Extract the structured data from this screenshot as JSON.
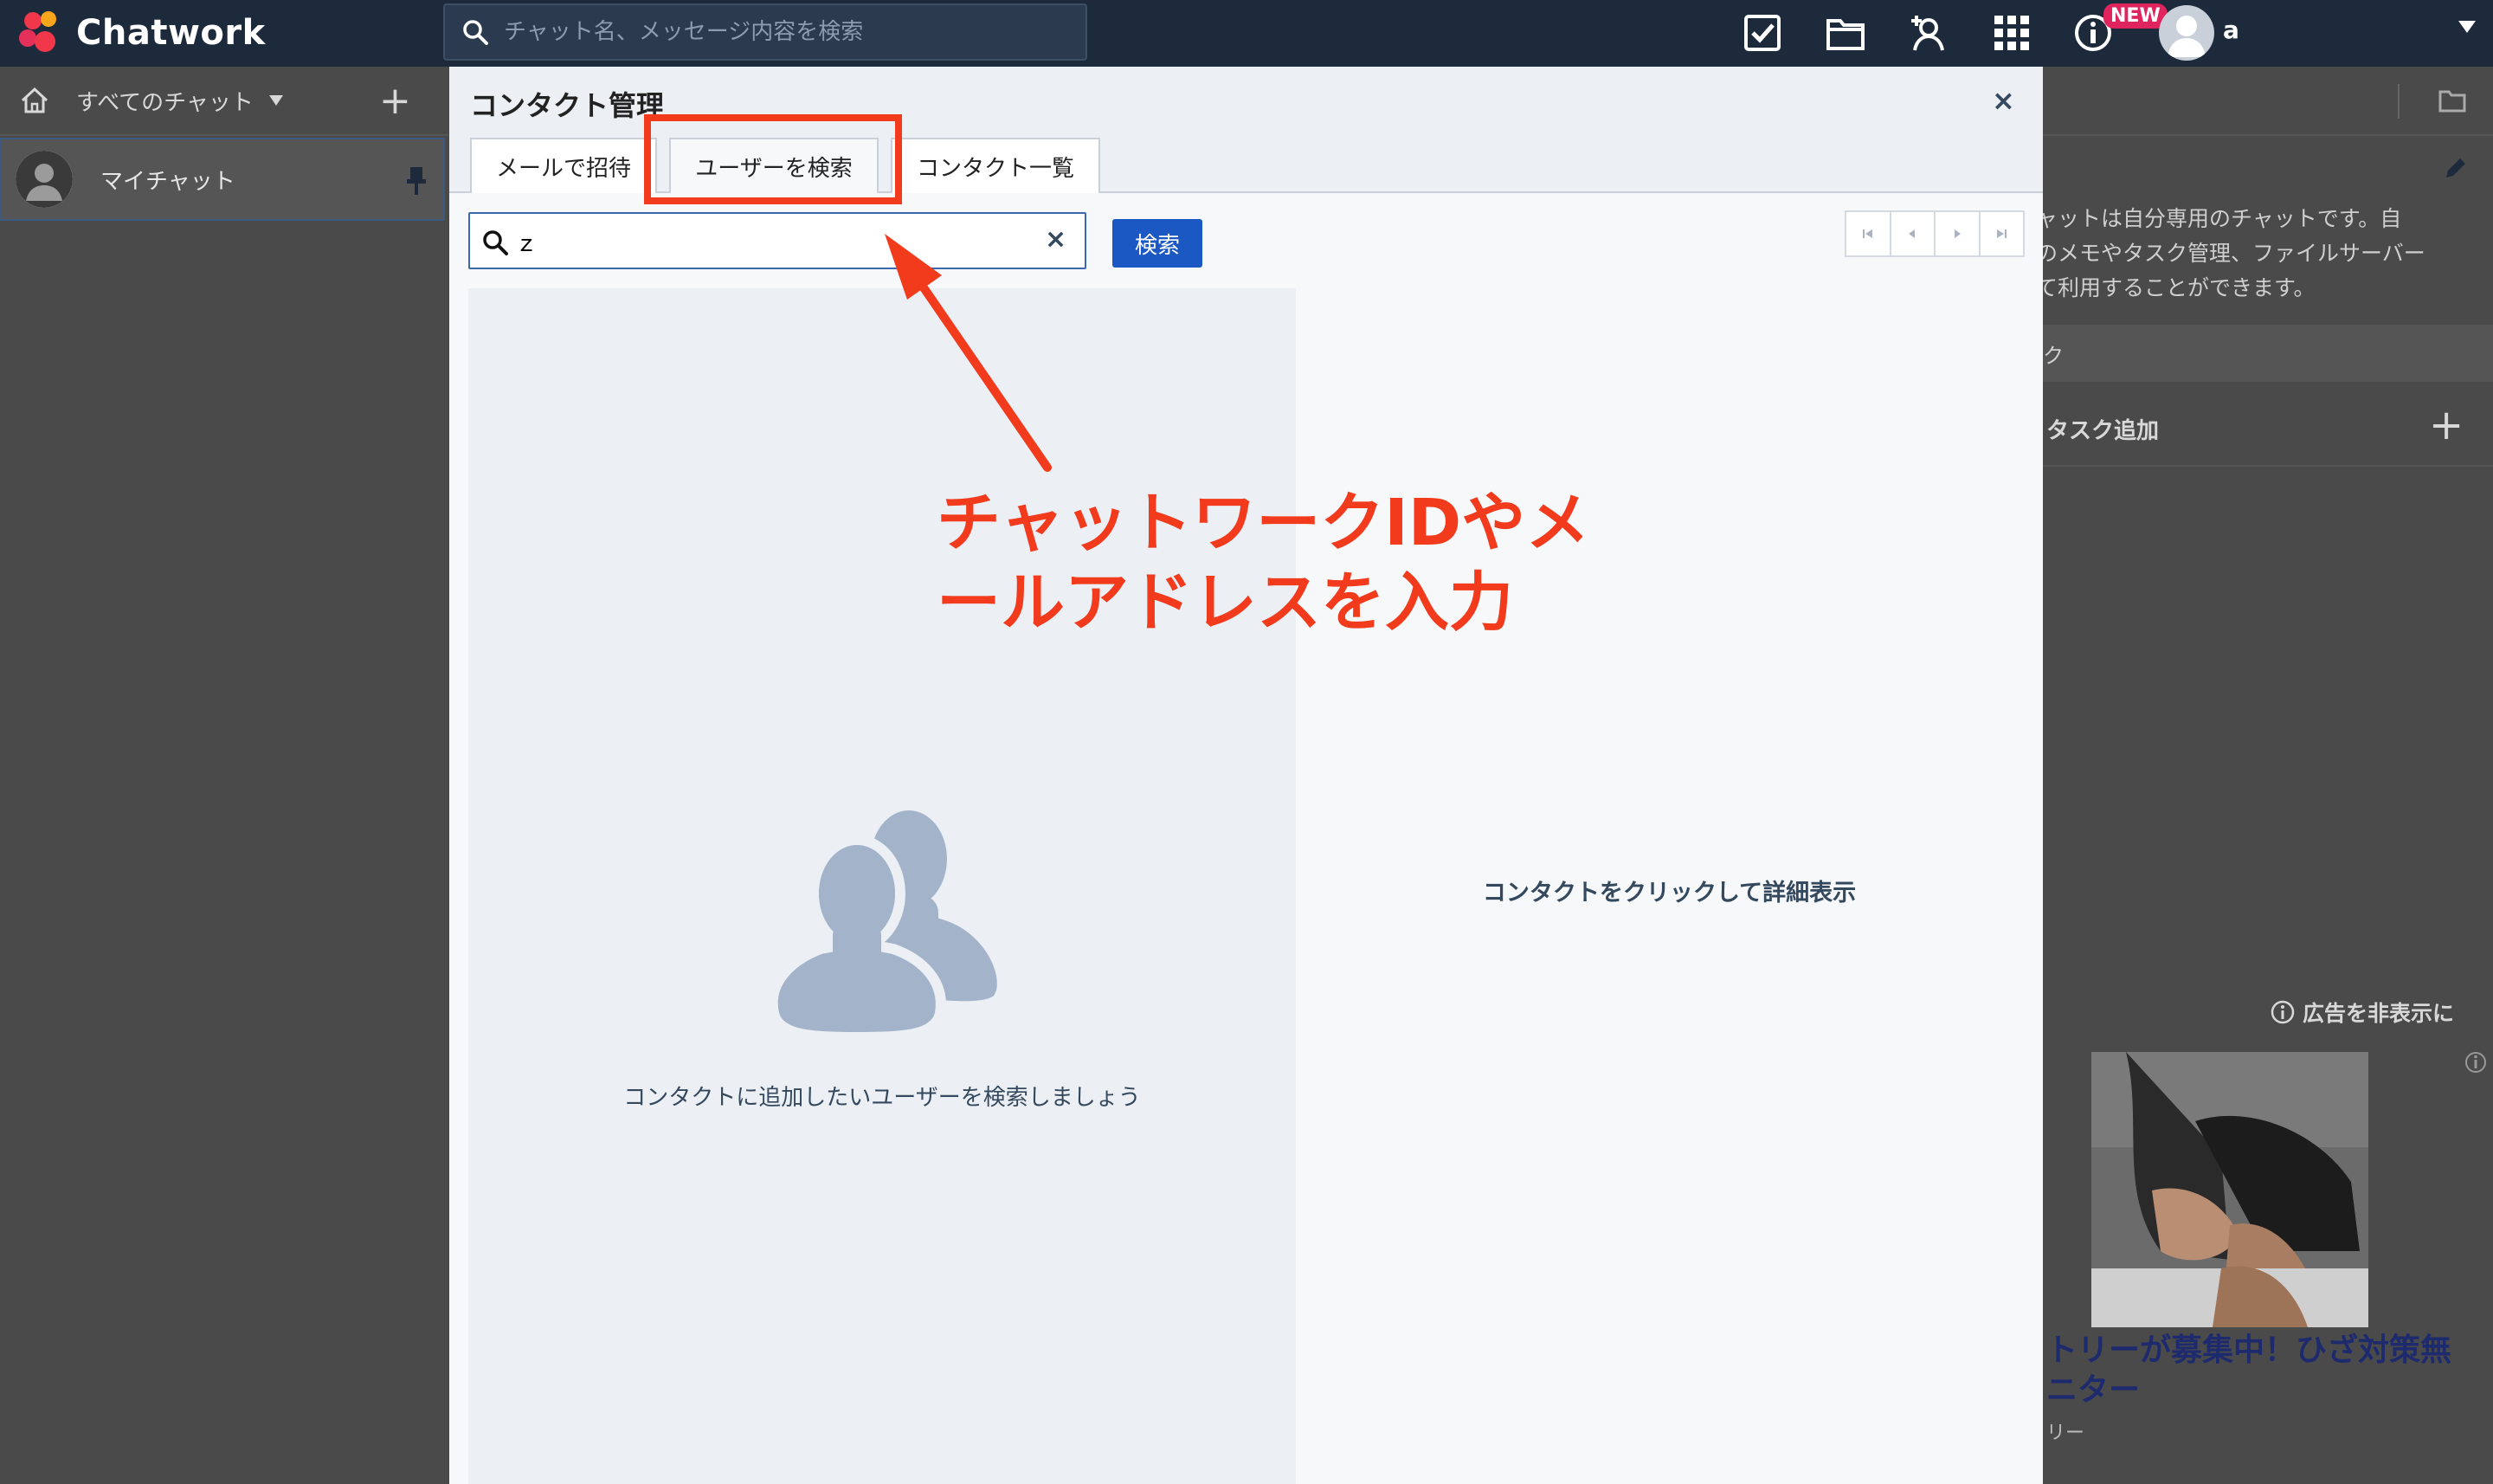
{
  "app": {
    "logo_text": "Chatwork",
    "search_placeholder": "チャット名、メッセージ内容を検索",
    "new_badge": "NEW",
    "user_name": "a"
  },
  "sidebar": {
    "filter_label": "すべてのチャット",
    "items": [
      {
        "label": "マイチャット"
      }
    ]
  },
  "right_panel": {
    "description": "チャットは自分専用のチャットです。自分のメモやタスク管理、ファイルサーバーとして利用することができます。",
    "description_lines": [
      "ャットは自分専用のチャットです。自",
      "のメモやタスク管理、ファイルサーバー",
      "て利用することができます。"
    ],
    "task_section": "ク",
    "task_add_label": "タスク追加",
    "ad_hide_label": "広告を非表示に",
    "ad_title_lines": [
      "トリーが募集中！ひざ対策無",
      "ニター"
    ],
    "ad_sub": "リー"
  },
  "modal": {
    "title": "コンタクト管理",
    "close_symbol": "×",
    "tabs": [
      {
        "label": "メールで招待",
        "active": false
      },
      {
        "label": "ユーザーを検索",
        "active": true
      },
      {
        "label": "コンタクト一覧",
        "active": false
      }
    ],
    "search_value": "ｚ",
    "clear_symbol": "×",
    "search_button": "検索",
    "empty_state_text": "コンタクトに追加したいユーザーを検索しましょう",
    "detail_placeholder": "コンタクトをクリックして詳細表示"
  },
  "annotation": {
    "lines": [
      "チャットワークIDやメ",
      "ールアドレスを入力"
    ],
    "color": "#f23a1c"
  },
  "colors": {
    "topbar": "#1d2a3b",
    "accent_button": "#1c58c4",
    "badge": "#e0245e",
    "highlight": "#f23a1c"
  }
}
